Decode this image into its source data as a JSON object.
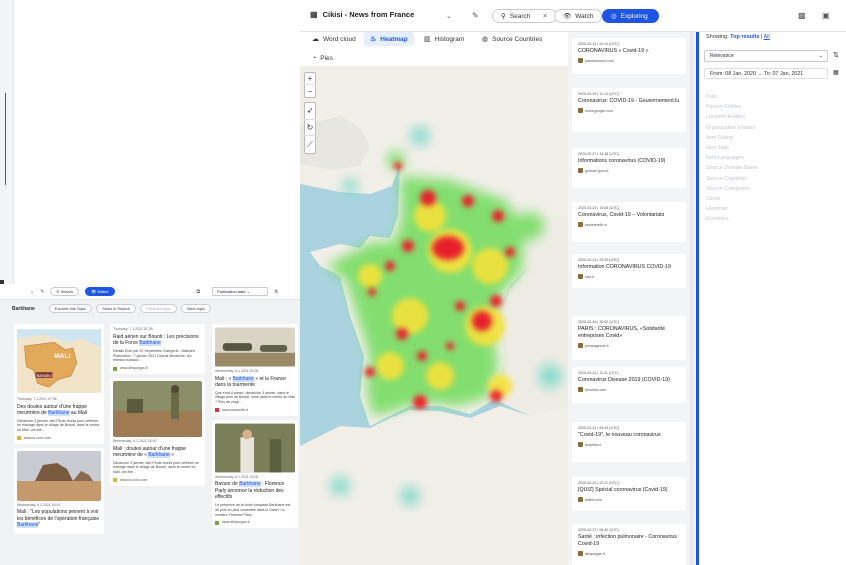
{
  "main": {
    "title": "Cikisi - News from France",
    "header": {
      "search_label": "Search",
      "watch_label": "Watch",
      "exploring_label": "Exploring"
    },
    "tabs": [
      {
        "label": "Word cloud",
        "icon": "cloud-icon"
      },
      {
        "label": "Heatmap",
        "icon": "flame-icon",
        "active": true
      },
      {
        "label": "Histogram",
        "icon": "histogram-icon"
      },
      {
        "label": "Source Countries",
        "icon": "globe-icon"
      },
      {
        "label": "Pies",
        "icon": "clock-icon"
      }
    ],
    "map": {
      "zoom_in": "+",
      "zoom_out": "−"
    },
    "results": [
      {
        "date": "2020-02-11 | 10:10 (UTC)",
        "title": "CORONAVIRUS « Covid-19 »",
        "source": "parolebourse.com"
      },
      {
        "date": "2020-02-29 | 11:13 (UTC)",
        "title": "Coronavirus: COVID-19 - Gouvernement.lu",
        "source": "news.google.com"
      },
      {
        "date": "2020-02-27 | 14:38 (UTC)",
        "title": "Informations coronavirus (COVID-19)",
        "source": "gironde.gouv.fr"
      },
      {
        "date": "2020-03-24 | 13:08 (UTC)",
        "title": "Coronavirus, Covid-19 – Volontariats",
        "source": "santelereflo.fr"
      },
      {
        "date": "2020-02-13 | 22:00 (UTC)",
        "title": "Information CORONAVIRUS COVID-19",
        "source": "vice.fr"
      },
      {
        "date": "2020-03-18 | 20:00 (UTC)",
        "title": "PARIS : CORONAVIRUS, «Solidarité entreprises Covid»",
        "source": "pressagence.fr"
      },
      {
        "date": "2020-03-12 | 11:11 (UTC)",
        "title": "Coronavirus Disease 2019 (COVID-19)",
        "source": "bemiinfo.com"
      },
      {
        "date": "2020-01-31 | 09:43 (UTC)",
        "title": "\"Covid-19\", le nouveau coronavirus",
        "source": "lexpress.fr"
      },
      {
        "date": "2020-04-22 | 22:11 (UTC)",
        "title": "[QUIZ] Spécial coronavirus (Covid-19)",
        "source": "twitter.com"
      },
      {
        "date": "2020-02-27 | 06:30 (UTC)",
        "title": "Santé : infection pulmonaire - Coronavirus Covid-19",
        "source": "afriquegas.fr"
      }
    ],
    "panel": {
      "showing_label": "Showing:",
      "top_results": "Top results",
      "separator": "|",
      "all": "All",
      "relevance": "Relevance",
      "date_range": "From: 08 Jan, 2020 → To: 07 Jan, 2021",
      "filters": [
        "Date",
        "Person Entities",
        "Location Entities",
        "Organization Entities",
        "Item Rating",
        "Item Tags",
        "Item Languages",
        "Source Domain Name",
        "Source Countries",
        "Source Categories",
        "Cloud",
        "Heatmap",
        "Countries"
      ]
    }
  },
  "background": {
    "search_label": "Search",
    "watch_label": "Watch",
    "publication_date": "Publication date",
    "query": "Barkhane",
    "actions": [
      "Explore this Topic",
      "Show in Search"
    ],
    "pager": [
      "Previous topic",
      "Next topic"
    ],
    "cards": [
      {
        "meta": "Thursday, 7.1.2021 07:06",
        "title_pre": "Des doutes autour d'une frappe meurtrière de ",
        "hl": "Barkhane",
        "title_post": " au Mali",
        "text": "Dimanche 3 janvier, des Peuls réunis pour célébrer un mariage dans le village de Bounti, dans le centre du Mali, ont été...",
        "source": "www.la-croix.com",
        "map_label_1": "MALI",
        "map_label_2": "Bamako"
      },
      {
        "meta": "Thursday, 7.1.2021 01:28",
        "title_pre": "Raid aérien sur Bounti : Les précisions de la Force ",
        "hl": "Barkhane",
        "title_post": "",
        "text": "Détails Écrit par 22 Septembre Catégorie : Maliweb Publication : 7 janvier 2021 Depuis dimanche, les réseaux sociaux...",
        "source": "www.afriquegas.fr"
      },
      {
        "meta": "Wednesday, 6.1.2021 20:00",
        "title_pre": "Mali : « ",
        "hl": "Barkhane",
        "title_post": " » et la France dans la tourmente",
        "text": "Que s'est-il passé, dimanche 3 janvier, dans le village peul de Bounti, situé dans le centre du Mali ? Plus de vingt...",
        "source": "www.humanite.fr"
      },
      {
        "meta": "Wednesday, 6.1.2021 18:00",
        "title_pre": "Mali : doutes autour d'une frappe meurtrière de « ",
        "hl": "Barkhane",
        "title_post": " »",
        "text": "Dimanche 3 janvier, des Peuls réunis pour célébrer un mariage dans le village de Bounti, dans le centre du Mali, ont été...",
        "source": "www.la-croix.com"
      },
      {
        "meta": "Wednesday, 6.1.2021 18:30",
        "title_pre": "Bavure de ",
        "hl": "Barkhane",
        "title_post": " : Florence Parly annonce la réduction des effectifs",
        "text": "La présence de la force française Barkhane est de plus en plus contestée dans le Sahel. La ministre Florence Parly...",
        "source": "www.afriquegas.fr"
      },
      {
        "meta": "Wednesday, 6.1.2021 16:01",
        "title_pre": "Mali : \"Les populations peinent à voir les bénéfices de l'opération française ",
        "hl": "Barkhane",
        "title_post": "\"",
        "text": "",
        "source": ""
      }
    ]
  }
}
